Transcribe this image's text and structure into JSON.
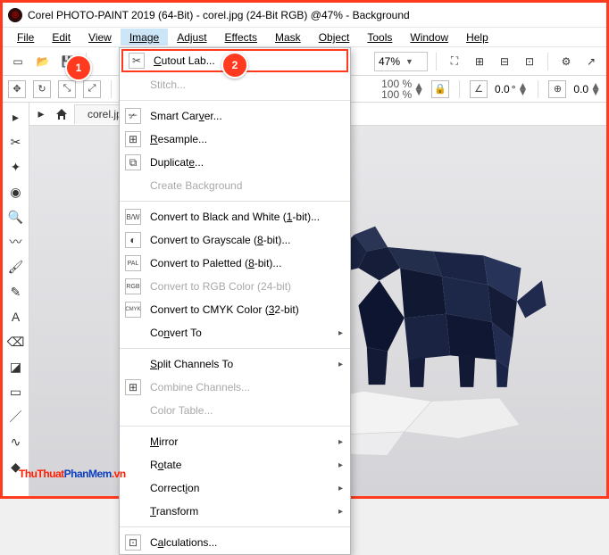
{
  "window": {
    "title": "Corel PHOTO-PAINT 2019 (64-Bit) - corel.jpg (24-Bit RGB) @47% - Background"
  },
  "menu": {
    "file": "File",
    "edit": "Edit",
    "view": "View",
    "image": "Image",
    "adjust": "Adjust",
    "effects": "Effects",
    "mask": "Mask",
    "object": "Object",
    "tools": "Tools",
    "window": "Window",
    "help": "Help"
  },
  "toolbar": {
    "zoom_value": "47%"
  },
  "propbar": {
    "pct1": "100 %",
    "pct2": "100 %",
    "angle": "0.0",
    "deg": "°"
  },
  "tabs": {
    "doc": "corel.jpg"
  },
  "dropdown": {
    "cutout": "Cutout Lab...",
    "stitch": "Stitch...",
    "smartcarver": "Smart Carver...",
    "resample": "Resample...",
    "duplicate": "Duplicate...",
    "createbg": "Create Background",
    "convbw": "Convert to Black and White (1-bit)...",
    "convgray": "Convert to Grayscale (8-bit)...",
    "convpal": "Convert to Paletted (8-bit)...",
    "convrgb": "Convert to RGB Color (24-bit)",
    "convcmyk": "Convert to CMYK Color (32-bit)",
    "convto": "Convert To",
    "splitch": "Split Channels To",
    "combch": "Combine Channels...",
    "coltable": "Color Table...",
    "mirror": "Mirror",
    "rotate": "Rotate",
    "correction": "Correction",
    "transform": "Transform",
    "calc": "Calculations..."
  },
  "badges": {
    "one": "1",
    "two": "2"
  },
  "watermark": {
    "a": "ThuThuat",
    "b": "PhanMem",
    "c": ".vn"
  }
}
